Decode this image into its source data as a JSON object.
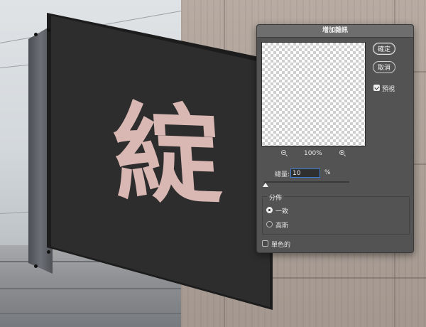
{
  "dialog": {
    "title": "增加雜訊",
    "ok_label": "確定",
    "cancel_label": "取消",
    "preview_label": "預視",
    "preview_checked": true,
    "zoom_level": "100%",
    "zoom_out_icon": "zoom-out-icon",
    "zoom_in_icon": "zoom-in-icon",
    "amount_label": "總量:",
    "amount_value": "10",
    "amount_unit": "%",
    "amount_slider_fraction": 0.02,
    "distribution": {
      "title": "分佈",
      "options": [
        {
          "label": "一致",
          "selected": true
        },
        {
          "label": "高斯",
          "selected": false
        }
      ]
    },
    "monochrome_label": "單色的",
    "monochrome_checked": false
  },
  "sign": {
    "glyph": "綻"
  },
  "colors": {
    "dialog_bg": "#535353",
    "titlebar_bg": "#6e6e6e",
    "input_focus": "#3c7cd4",
    "sign_text": "#d9b7b3"
  }
}
